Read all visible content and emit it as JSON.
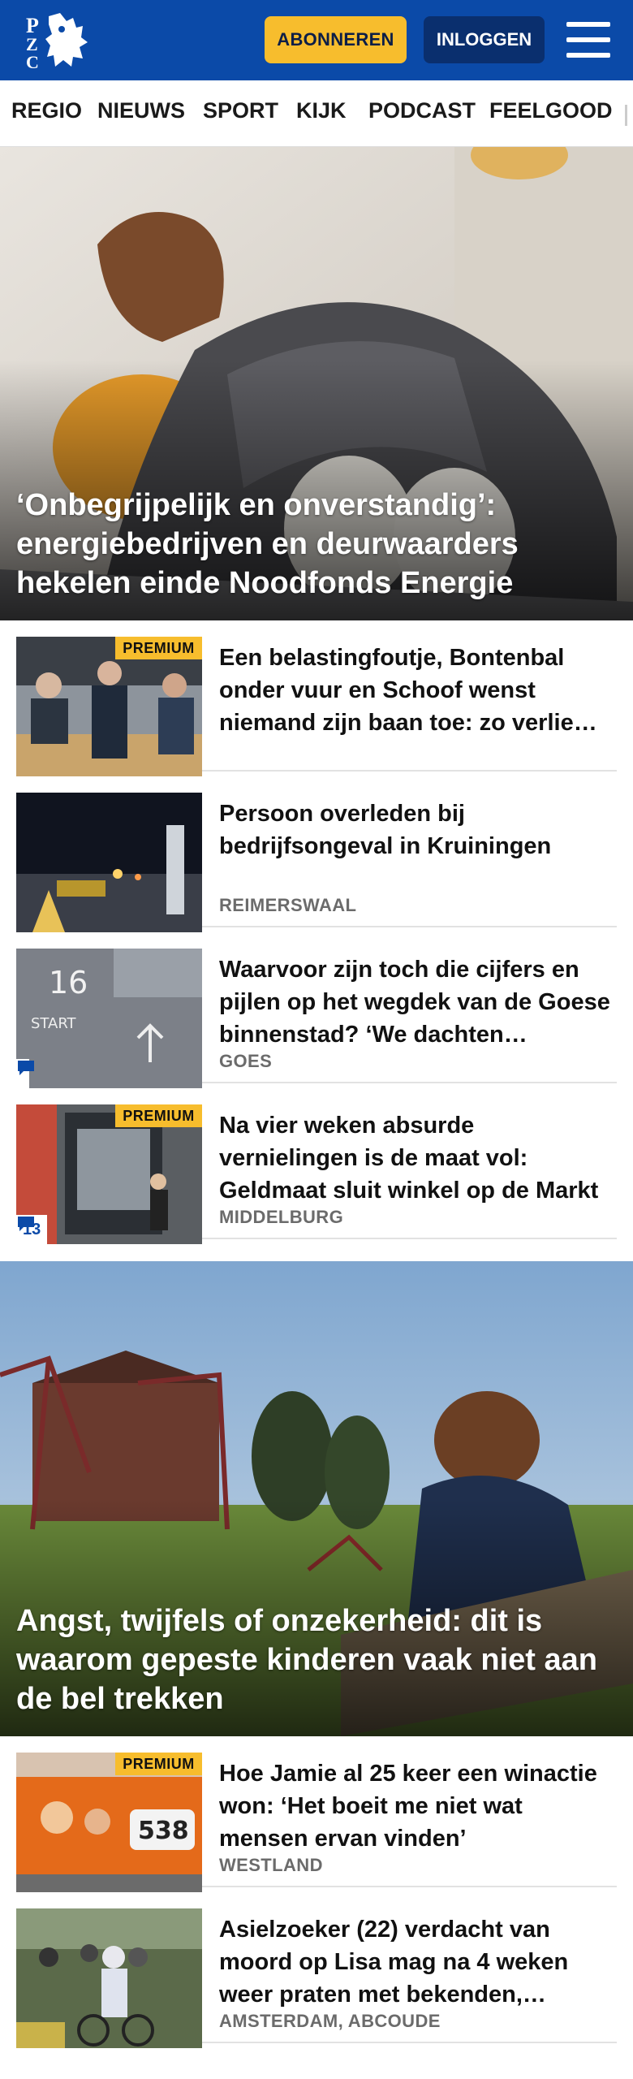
{
  "header": {
    "logo_text": "PZC",
    "subscribe_label": "ABONNEREN",
    "login_label": "INLOGGEN",
    "brand_color": "#0b4aa8",
    "accent_color": "#f7bd2d"
  },
  "nav": {
    "items": [
      "REGIO",
      "NIEUWS",
      "SPORT",
      "KIJK",
      "PODCAST",
      "FEELGOOD"
    ]
  },
  "hero1": {
    "title": "‘Onbegrijpelijk en onverstandig’: energiebedrijven en deurwaarders hekelen einde Noodfonds Energie"
  },
  "list1": [
    {
      "title": "Een belastingfoutje, Bontenbal onder vuur en Schoof wenst niemand zijn baan toe: zo verlie…",
      "tag": "",
      "premium": "PREMIUM",
      "comments": ""
    },
    {
      "title": "Persoon overleden bij bedrijfsongeval in Kruiningen",
      "tag": "REIMERSWAAL",
      "premium": "",
      "comments": ""
    },
    {
      "title": "Waarvoor zijn toch die cijfers en pijlen op het wegdek van de Goese binnenstad? ‘We dachten…",
      "tag": "GOES",
      "premium": "",
      "comments": ""
    },
    {
      "title": "Na vier weken absurde vernielingen is de maat vol: Geldmaat sluit winkel op de Markt in…",
      "tag": "MIDDELBURG",
      "premium": "PREMIUM",
      "comments": "13"
    }
  ],
  "hero2": {
    "title": "Angst, twijfels of onzekerheid: dit is waarom gepeste kinderen vaak niet aan de bel trekken"
  },
  "list2": [
    {
      "title": "Hoe Jamie al 25 keer een winactie won: ‘Het boeit me niet wat mensen ervan vinden’",
      "tag": "WESTLAND",
      "premium": "PREMIUM",
      "comments": ""
    },
    {
      "title": "Asielzoeker (22) verdacht van moord op Lisa mag na 4 weken weer praten met bekenden,…",
      "tag": "AMSTERDAM, ABCOUDE",
      "premium": "",
      "comments": ""
    }
  ]
}
